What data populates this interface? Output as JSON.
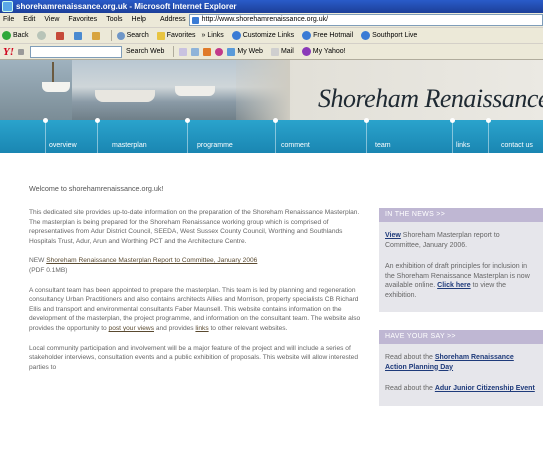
{
  "window": {
    "title": "shorehamrenaissance.org.uk - Microsoft Internet Explorer"
  },
  "menubar": {
    "items": [
      "File",
      "Edit",
      "View",
      "Favorites",
      "Tools",
      "Help"
    ],
    "address_label": "Address",
    "address_value": "http://www.shorehamrenaissance.org.uk/"
  },
  "toolbar": {
    "back": "Back",
    "search": "Search",
    "favorites": "Favorites",
    "links": "» Links",
    "customize_links": "Customize Links",
    "free_hotmail": "Free Hotmail",
    "southport_live": "Southport Live"
  },
  "yahoo_toolbar": {
    "logo": "Y!",
    "search_web": "Search Web",
    "my_web": "My Web",
    "mail": "Mail",
    "my_yahoo": "My Yahoo!"
  },
  "banner": {
    "logo_first": "Shoreham",
    "logo_second": "Renaissance"
  },
  "nav": [
    "overview",
    "masterplan",
    "programme",
    "comment",
    "team",
    "links",
    "contact us"
  ],
  "main": {
    "heading": "Welcome to shorehamrenaissance.org.uk!",
    "p1": "This dedicated site provides up-to-date information on the preparation of the Shoreham Renaissance Masterplan. The masterplan is being prepared for the Shoreham Renaissance working group which is comprised of representatives from Adur District Council, SEEDA, West Sussex County Council, Worthing and Southlands Hospitals Trust, Adur, Arun and Worthing PCT and the Architecture Centre.",
    "p2_prefix": "NEW ",
    "p2_link": "Shoreham Renaissance Masterplan Report to Committee, January 2006",
    "p2_suffix": "(PDF 0.1MB)",
    "p3_a": "A consultant team has been appointed to prepare the masterplan. This team is led by planning and regeneration consultancy Urban Practitioners and also contains architects Allies and Morrison, property specialists CB Richard Ellis and transport and environmental consultants Faber Maunsell. This website contains information on the development of the masterplan, the project programme, and information on the consultant team. The website also provides the opportunity to ",
    "p3_link1": "post your views",
    "p3_b": " and provides ",
    "p3_link2": "links",
    "p3_c": " to other relevant websites.",
    "p4": "Local community participation and involvement will be a major feature of the project and will include a series of stakeholder interviews, consultation events and a public exhibition of proposals. This website will allow interested parties to"
  },
  "sidebar": {
    "news_header": "IN THE NEWS >>",
    "news1_link": "View",
    "news1_text": " Shoreham Masterplan report to Committee, January 2006.",
    "news2_text": "An exhibition of draft principles for inclusion in the Shoreham Renaissance Masterplan is now available online. ",
    "news2_link": "Click here",
    "news2_suffix": " to view the exhibition.",
    "say_header": "HAVE YOUR SAY >>",
    "say1_prefix": "Read about the ",
    "say1_link": "Shoreham Renaissance Action Planning Day",
    "say2_prefix": "Read about the ",
    "say2_link": "Adur Junior Citizenship Event"
  }
}
